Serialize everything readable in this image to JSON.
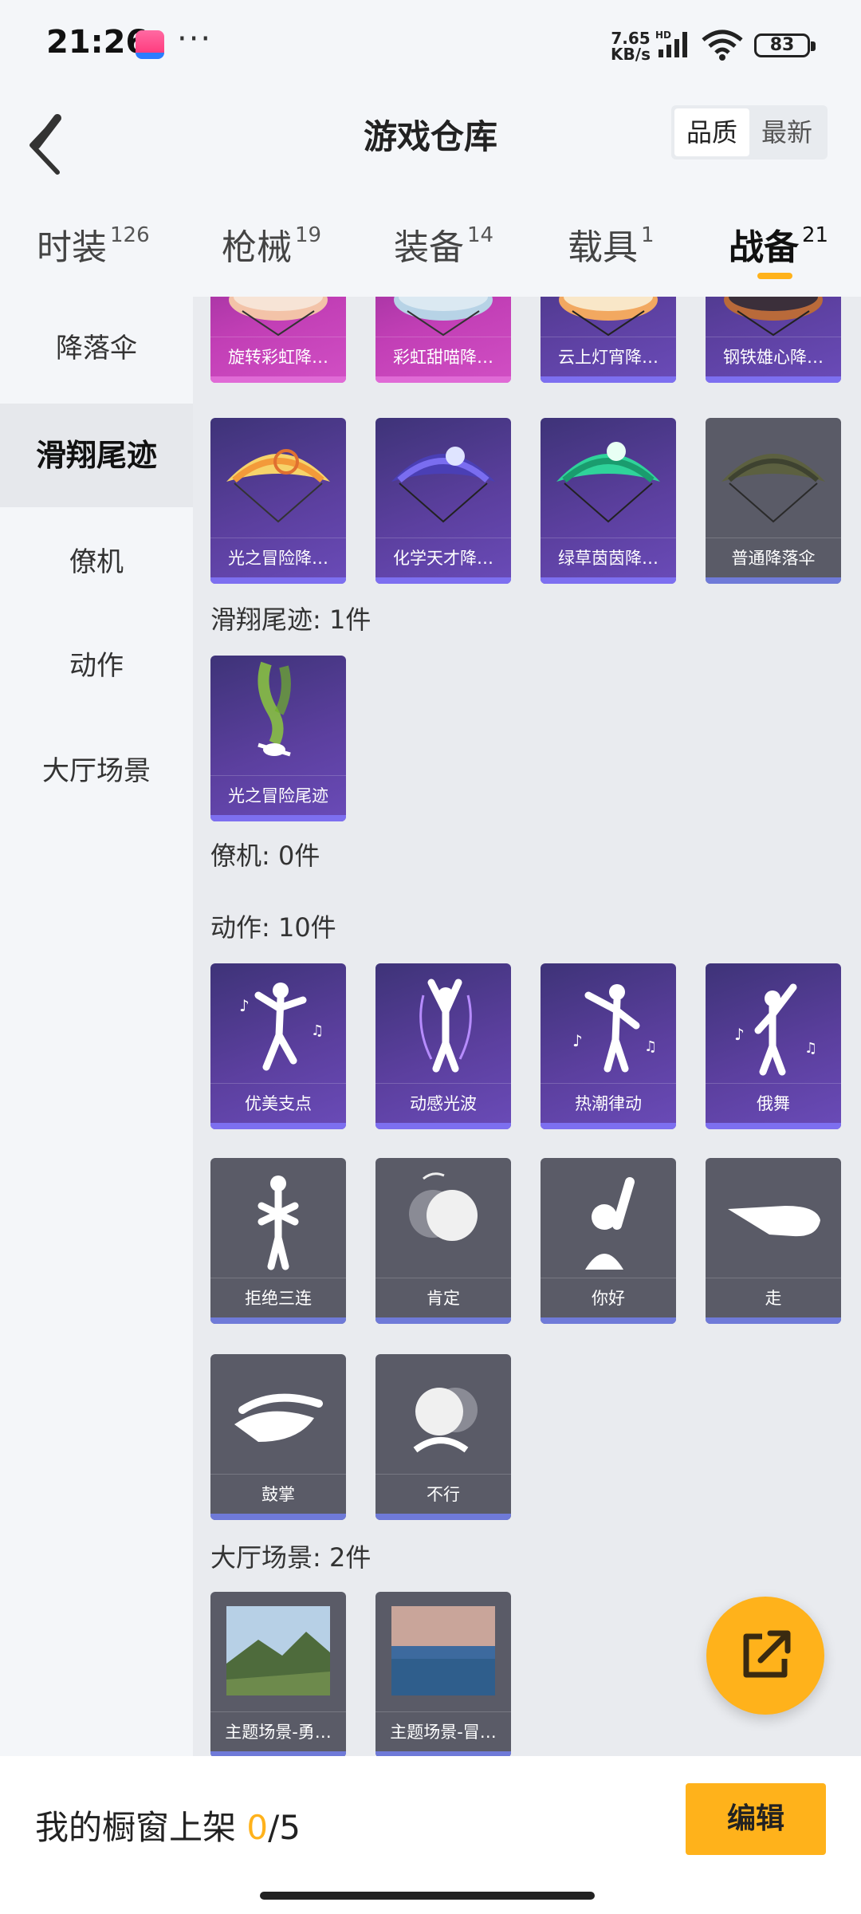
{
  "status_bar": {
    "time": "21:26",
    "more": "···",
    "net_speed_value": "7.65",
    "net_speed_unit": "KB/s",
    "network_badge": "HD",
    "battery": "83"
  },
  "header": {
    "title": "游戏仓库",
    "sort_options": [
      {
        "label": "品质",
        "active": true
      },
      {
        "label": "最新",
        "active": false
      }
    ]
  },
  "category_tabs": [
    {
      "label": "时装",
      "count": "126",
      "active": false
    },
    {
      "label": "枪械",
      "count": "19",
      "active": false
    },
    {
      "label": "装备",
      "count": "14",
      "active": false
    },
    {
      "label": "载具",
      "count": "1",
      "active": false
    },
    {
      "label": "战备",
      "count": "21",
      "active": true
    }
  ],
  "sidebar": [
    {
      "label": "降落伞",
      "active": false
    },
    {
      "label": "滑翔尾迹",
      "active": true
    },
    {
      "label": "僚机",
      "active": false
    },
    {
      "label": "动作",
      "active": false
    },
    {
      "label": "大厅场景",
      "active": false
    }
  ],
  "sections": {
    "parachute_row1": [
      "旋转彩虹降…",
      "彩虹甜喵降…",
      "云上灯宵降…",
      "钢铁雄心降…"
    ],
    "parachute_row2": [
      "光之冒险降…",
      "化学天才降…",
      "绿草茵茵降…",
      "普通降落伞"
    ],
    "trail_title": "滑翔尾迹: 1件",
    "trail_items": [
      "光之冒险尾迹"
    ],
    "wingman_title": "僚机: 0件",
    "emote_title": "动作: 10件",
    "emote_row1": [
      "优美支点",
      "动感光波",
      "热潮律动",
      "俄舞"
    ],
    "emote_row2": [
      "拒绝三连",
      "肯定",
      "你好",
      "走"
    ],
    "emote_row3": [
      "鼓掌",
      "不行"
    ],
    "lobby_title": "大厅场景: 2件",
    "lobby_items": [
      "主题场景-勇…",
      "主题场景-冒…"
    ]
  },
  "bottom": {
    "showcase_label": "我的橱窗上架",
    "showcase_current": "0",
    "showcase_total": "/5",
    "edit_label": "编辑"
  },
  "colors": {
    "accent": "#ffb21b",
    "card_purple": "#5b3f9e",
    "card_gray": "#5a5b67",
    "card_magenta": "#c23fb6"
  }
}
